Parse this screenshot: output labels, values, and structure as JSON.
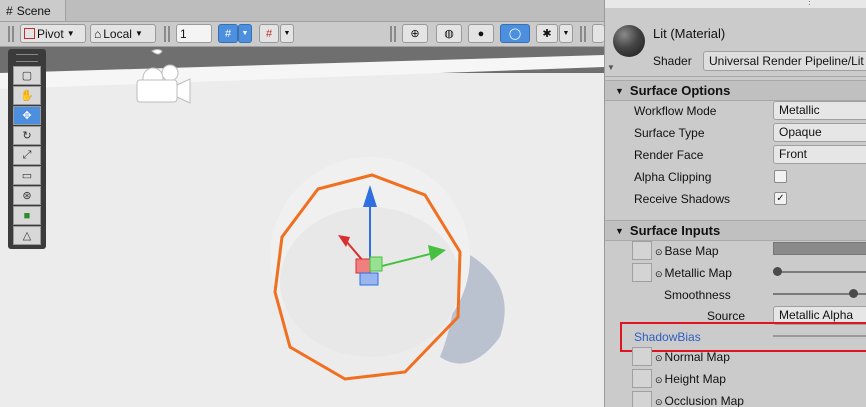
{
  "scene": {
    "tab_label": "Scene",
    "toolbar": {
      "pivot_label": "Pivot",
      "local_label": "Local",
      "grid_value": "1"
    }
  },
  "inspector": {
    "material_title": "Lit (Material)",
    "shader_label": "Shader",
    "shader_value": "Universal Render Pipeline/Lit",
    "surface_options": {
      "header": "Surface Options",
      "props": [
        {
          "label": "Workflow Mode",
          "value": "Metallic"
        },
        {
          "label": "Surface Type",
          "value": "Opaque"
        },
        {
          "label": "Render Face",
          "value": "Front"
        }
      ],
      "alpha_clipping_label": "Alpha Clipping",
      "alpha_clipping_checked": false,
      "receive_shadows_label": "Receive Shadows",
      "receive_shadows_checked": true
    },
    "surface_inputs": {
      "header": "Surface Inputs",
      "base_map_label": "Base Map",
      "metallic_map_label": "Metallic Map",
      "smoothness_label": "Smoothness",
      "source_label": "Source",
      "source_value": "Metallic Alpha",
      "shadow_bias_label": "ShadowBias",
      "normal_map_label": "Normal Map",
      "height_map_label": "Height Map",
      "occlusion_map_label": "Occlusion Map"
    }
  },
  "colors": {
    "selection_outline": "#f07020",
    "highlight_box": "#e0141e",
    "gizmo_y": "#2f6fe0",
    "gizmo_x": "#d83030",
    "gizmo_z": "#46c040",
    "accent_blue": "#4c8fde"
  }
}
